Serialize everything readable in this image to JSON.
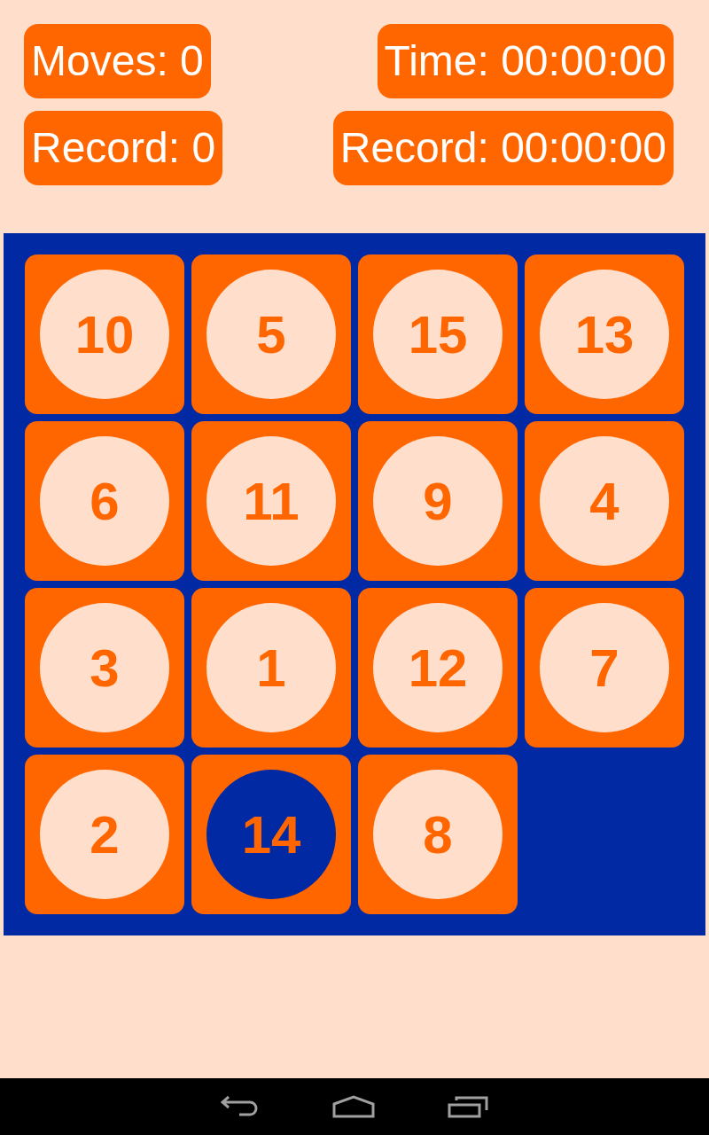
{
  "stats": [
    {
      "left": "Moves: 0",
      "right": "Time: 00:00:00"
    },
    {
      "left": "Record: 0",
      "right": "Record: 00:00:00"
    }
  ],
  "tiles": [
    {
      "kind": "tile",
      "number": "10",
      "selected": false
    },
    {
      "kind": "tile",
      "number": "5",
      "selected": false
    },
    {
      "kind": "tile",
      "number": "15",
      "selected": false
    },
    {
      "kind": "tile",
      "number": "13",
      "selected": false
    },
    {
      "kind": "tile",
      "number": "6",
      "selected": false
    },
    {
      "kind": "tile",
      "number": "11",
      "selected": false
    },
    {
      "kind": "tile",
      "number": "9",
      "selected": false
    },
    {
      "kind": "tile",
      "number": "4",
      "selected": false
    },
    {
      "kind": "tile",
      "number": "3",
      "selected": false
    },
    {
      "kind": "tile",
      "number": "1",
      "selected": false
    },
    {
      "kind": "tile",
      "number": "12",
      "selected": false
    },
    {
      "kind": "tile",
      "number": "7",
      "selected": false
    },
    {
      "kind": "tile",
      "number": "2",
      "selected": false
    },
    {
      "kind": "tile",
      "number": "14",
      "selected": true
    },
    {
      "kind": "tile",
      "number": "8",
      "selected": false
    },
    {
      "kind": "empty"
    }
  ]
}
